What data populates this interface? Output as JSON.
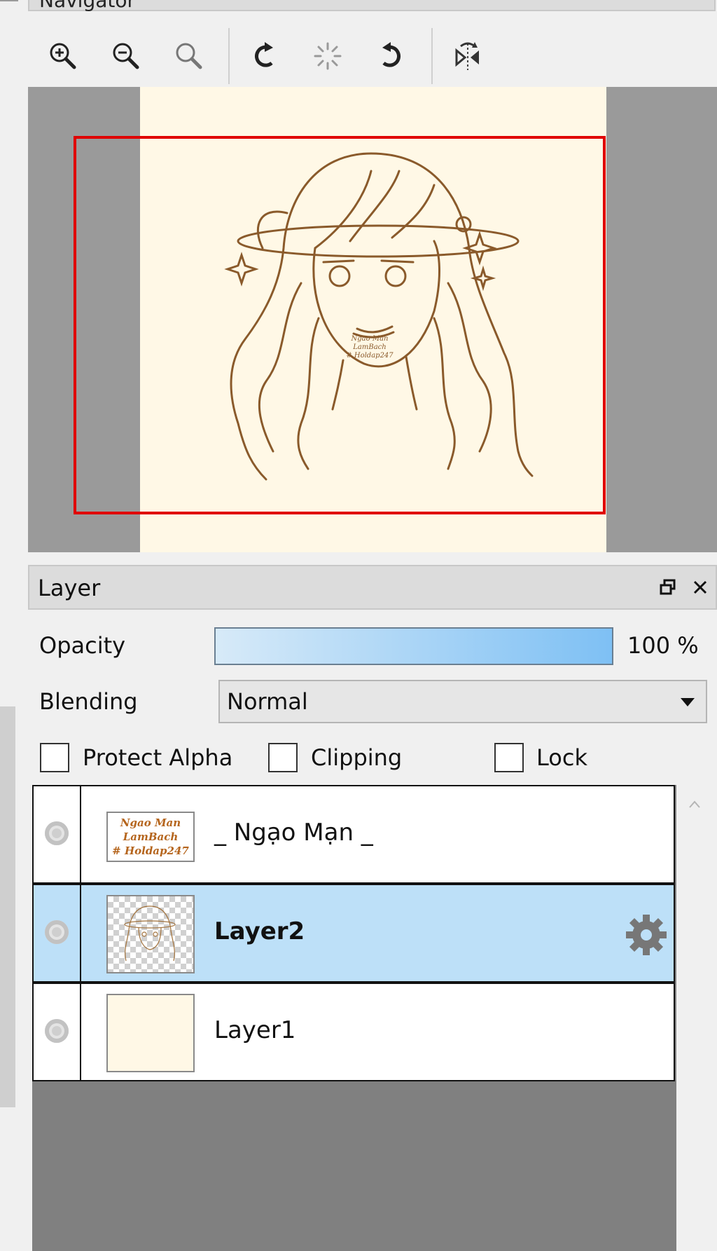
{
  "navigator": {
    "title": "Navigator",
    "toolbar": [
      {
        "name": "zoom-in-icon"
      },
      {
        "name": "zoom-out-icon"
      },
      {
        "name": "zoom-reset-icon"
      },
      {
        "name": "rotate-left-icon"
      },
      {
        "name": "rotate-reset-icon"
      },
      {
        "name": "rotate-right-icon"
      },
      {
        "name": "flip-horizontal-icon"
      }
    ],
    "watermark_lines": [
      "Ngao Man",
      "LamBach",
      "# Holdap247"
    ]
  },
  "layer_panel": {
    "title": "Layer",
    "opacity_label": "Opacity",
    "opacity_value": "100 %",
    "opacity_fraction": 1.0,
    "blending_label": "Blending",
    "blending_value": "Normal",
    "checkboxes": {
      "protect_alpha": "Protect Alpha",
      "clipping": "Clipping",
      "lock": "Lock"
    },
    "layers": [
      {
        "name": "_ Ngạo Mạn _",
        "thumb_lines": [
          "Ngao Man",
          "LamBach",
          "# Holdap247"
        ],
        "selected": false
      },
      {
        "name": "Layer2",
        "selected": true
      },
      {
        "name": "Layer1",
        "selected": false
      }
    ]
  },
  "colors": {
    "selection": "#bde0f8",
    "viewport_rect": "#e00000",
    "paper": "#fff8e6",
    "sketch": "#8a5a2b"
  }
}
